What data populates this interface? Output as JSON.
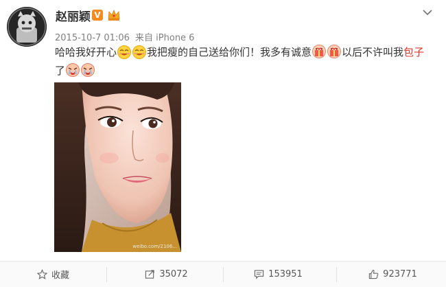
{
  "post": {
    "author": "赵丽颖",
    "verified_badge": "V",
    "timestamp": "2015-10-7 01:06",
    "source_prefix": "来自",
    "source": "iPhone 6",
    "text_parts": {
      "p1": "哈哈我好开心",
      "p2": "我把瘦的自己送给你们！我多有诚意",
      "p3": "以后不许叫我",
      "p4_red": "包子",
      "p5": "了"
    },
    "emojis": {
      "happy": "happy-face-emoji",
      "gift": "gift-emoji",
      "cry": "cry-emoji"
    },
    "watermark": "weibo.com/2106..."
  },
  "toolbar": {
    "favorite_label": "收藏",
    "repost_count": "35072",
    "comment_count": "153951",
    "like_count": "923771"
  },
  "colors": {
    "accent_red": "#e0352b",
    "badge_orange": "#f58a1f",
    "meta_gray": "#808080"
  }
}
